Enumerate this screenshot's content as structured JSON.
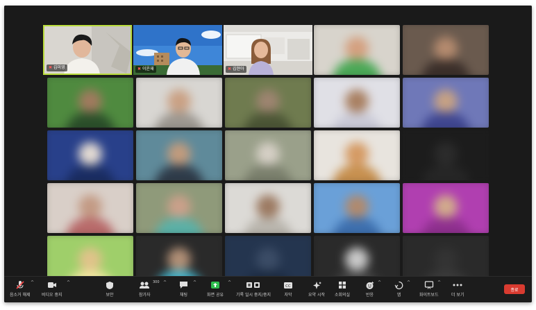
{
  "participants": {
    "featured": [
      {
        "name": "김미영",
        "mic_muted": true
      },
      {
        "name": "이윤재",
        "mic_muted": true
      },
      {
        "name": "김현아",
        "mic_muted": true
      }
    ]
  },
  "toolbar": {
    "unmute_label": "음소거 해제",
    "stop_video_label": "비디오 중지",
    "security_label": "보안",
    "participants_label": "참가자",
    "participants_count": "300",
    "chat_label": "채팅",
    "share_label": "화면 공유",
    "record_label": "기록 일시 중지/중지",
    "captions_label": "자막",
    "summary_label": "요약 시작",
    "rooms_label": "소회의실",
    "reactions_label": "반응",
    "apps_label": "앱",
    "whiteboard_label": "화이트보드",
    "more_label": "더 보기",
    "end_label": "종료"
  },
  "colors": {
    "active_speaker_border": "#b9dc3c",
    "share_green": "#2fbf4f",
    "end_red": "#d93b30"
  }
}
